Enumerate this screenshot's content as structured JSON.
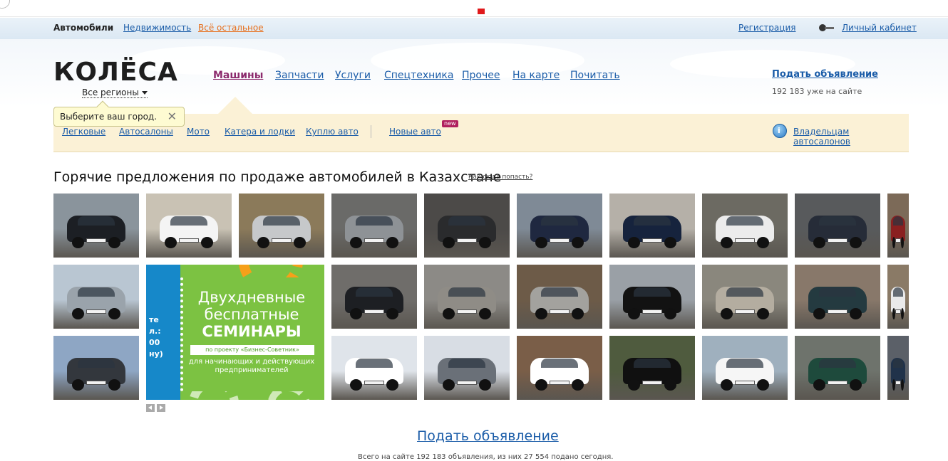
{
  "topbar": {
    "cars": "Автомобили",
    "realty": "Недвижимость",
    "other": "Всё остальное",
    "register": "Регистрация",
    "account": "Личный кабинет"
  },
  "logo": {
    "text": "КОЛЁСА"
  },
  "regions": {
    "label": "Все регионы"
  },
  "tooltip": {
    "text": "Выберите ваш город.",
    "close": "✕"
  },
  "mainnav": [
    "Машины",
    "Запчасти",
    "Услуги",
    "Спецтехника",
    "Прочее",
    "На карте",
    "Почитать"
  ],
  "post": {
    "label": "Подать объявление",
    "count": "192 183 уже на сайте"
  },
  "subnav": {
    "items": [
      "Легковые",
      "Автосалоны",
      "Мото",
      "Катера и лодки",
      "Куплю авто",
      "Новые авто"
    ],
    "badge": "new",
    "owners": "Владельцам автосалонов"
  },
  "hot": {
    "title": "Горячие предложения по продаже автомобилей в Казахстане",
    "how": "Как сюда попасть?"
  },
  "promo": {
    "line1": "Двухдневные бесплатные",
    "line2": "СЕМИНАРЫ",
    "ribbon": "по проекту «Бизнес-Советник»",
    "line3": "для начинающих и действующих предпринимателей",
    "stub": "те\nл.:\n00\nну)"
  },
  "gallery": {
    "tiles": [
      {
        "bg": "#8a949c",
        "car": "#1c1f24"
      },
      {
        "bg": "#c9c2b4",
        "car": "#f4f4f4"
      },
      {
        "bg": "#8b7a5a",
        "car": "#c6c8ca"
      },
      {
        "bg": "#6a6a68",
        "car": "#8e9296"
      },
      {
        "bg": "#4c4a48",
        "car": "#2a2b2d"
      },
      {
        "bg": "#7f8a96",
        "car": "#1f2840"
      },
      {
        "bg": "#b5b0a8",
        "car": "#16233d"
      },
      {
        "bg": "#6c6a62",
        "car": "#ececec"
      },
      {
        "bg": "#585a5c",
        "car": "#262c38"
      },
      {
        "bg": "#7c6a58",
        "car": "#8a2020"
      },
      {
        "bg": "#b9c6d2",
        "car": "#9aa3ab"
      },
      {
        "bg": "#6f6d6a",
        "car": "#1d1f23"
      },
      {
        "bg": "#8c8a86",
        "car": "#8f8c86"
      },
      {
        "bg": "#6d5b48",
        "car": "#a3a29e"
      },
      {
        "bg": "#9aa0a6",
        "car": "#121212"
      },
      {
        "bg": "#8a877d",
        "car": "#b4ada0"
      },
      {
        "bg": "#88786a",
        "car": "#243a40"
      },
      {
        "bg": "#8a7a66",
        "car": "#eaeaea"
      },
      {
        "bg": "#8ea6c4",
        "car": "#33373d"
      },
      {
        "bg": "#dfe4ea",
        "car": "#ffffff"
      },
      {
        "bg": "#d8dde4",
        "car": "#6a7078"
      },
      {
        "bg": "#7a5e48",
        "car": "#ffffff"
      },
      {
        "bg": "#4f5b3e",
        "car": "#101010"
      },
      {
        "bg": "#9fb0be",
        "car": "#f6f6f6"
      },
      {
        "bg": "#6e736c",
        "car": "#1e4a3c"
      },
      {
        "bg": "#5b6068",
        "car": "#20324a"
      }
    ]
  },
  "footer": {
    "post": "Подать объявление",
    "stats": "Всего на сайте 192 183 объявления, из них 27 554 подано сегодня."
  }
}
